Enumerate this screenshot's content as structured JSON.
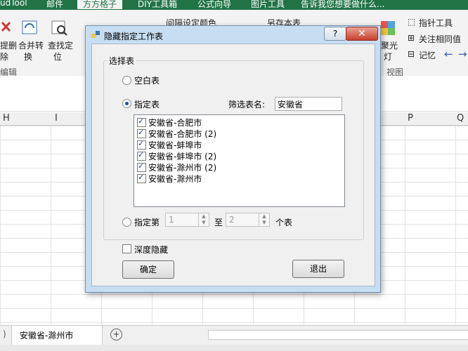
{
  "ribbon": {
    "tabs": [
      "udTool",
      "邮件",
      "方方格子",
      "DIY工具箱",
      "公式向导",
      "图片工具",
      "告诉我您想要做什么..."
    ],
    "active_tab_index": 2,
    "buttons": {
      "delete": "提删",
      "delete_sub": "除",
      "merge": "合并转",
      "merge_sub": "换",
      "find": "查找定",
      "find_sub": "位",
      "interval_color": "间隔设定颜色",
      "save_as_table": "另存本表",
      "focus_light": "聚光",
      "focus_light_sub": "灯",
      "pointer_tool": "指针工具",
      "follow_same": "关注相同值",
      "memory": "记忆"
    },
    "group_labels": {
      "edit": "编辑",
      "view": "视图"
    }
  },
  "columns": [
    "H",
    "I",
    "P",
    "Q"
  ],
  "sheet_tabs": [
    "安徽省-滁州市"
  ],
  "dialog": {
    "title": "隐藏指定工作表",
    "help_label": "?",
    "close_label": "✕",
    "group_label": "选择表",
    "blank_label": "空白表",
    "specified_label": "指定表",
    "filter_label": "筛选表名:",
    "filter_value": "安徽省",
    "sheets": [
      {
        "name": "安徽省-合肥市",
        "checked": true
      },
      {
        "name": "安徽省-合肥市 (2)",
        "checked": true
      },
      {
        "name": "安徽省-蚌埠市",
        "checked": true
      },
      {
        "name": "安徽省-蚌埠市 (2)",
        "checked": true
      },
      {
        "name": "安徽省-滁州市 (2)",
        "checked": true
      },
      {
        "name": "安徽省-滁州市",
        "checked": true
      }
    ],
    "nth_label": "指定第",
    "from_value": "1",
    "to_label": "至",
    "to_value": "2",
    "unit_label": "个表",
    "deep_hide_label": "深度隐藏",
    "ok_label": "确定",
    "exit_label": "退出"
  },
  "colors": {
    "excel_green": "#217346",
    "dialog_frame": "#c7ddf2",
    "close_red": "#c7402c"
  }
}
